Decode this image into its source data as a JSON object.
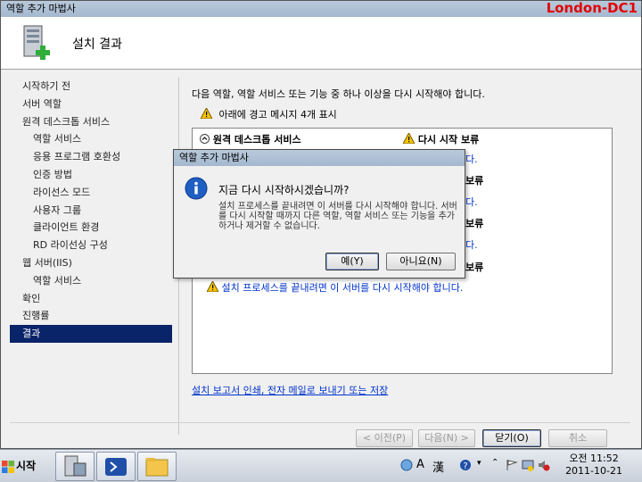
{
  "window": {
    "title": "역할 추가 마법사",
    "host_label": "London-DC1"
  },
  "header": {
    "title": "설치 결과"
  },
  "nav": {
    "items": [
      {
        "label": "시작하기 전",
        "sub": false,
        "active": false
      },
      {
        "label": "서버 역할",
        "sub": false,
        "active": false
      },
      {
        "label": "원격 데스크톱 서비스",
        "sub": false,
        "active": false
      },
      {
        "label": "역할 서비스",
        "sub": true,
        "active": false
      },
      {
        "label": "응용 프로그램 호환성",
        "sub": true,
        "active": false
      },
      {
        "label": "인증 방법",
        "sub": true,
        "active": false
      },
      {
        "label": "라이선스 모드",
        "sub": true,
        "active": false
      },
      {
        "label": "사용자 그룹",
        "sub": true,
        "active": false
      },
      {
        "label": "클라이언트 환경",
        "sub": true,
        "active": false
      },
      {
        "label": "RD 라이선싱 구성",
        "sub": true,
        "active": false
      },
      {
        "label": "웹 서버(IIS)",
        "sub": false,
        "active": false
      },
      {
        "label": "역할 서비스",
        "sub": true,
        "active": false
      },
      {
        "label": "확인",
        "sub": false,
        "active": false
      },
      {
        "label": "진행률",
        "sub": false,
        "active": false
      },
      {
        "label": "결과",
        "sub": false,
        "active": true
      }
    ]
  },
  "main": {
    "intro": "다음 역할, 역할 서비스 또는 기능 중 하나 이상을 다시 시작해야 합니다.",
    "warning_summary": "아래에 경고 메시지 4개 표시",
    "result_header": {
      "name": "원격 데스크톱 서비스",
      "status": "다시 시작 보류"
    },
    "partial_rows": [
      "다.",
      "보류",
      "다.",
      "보류",
      "다.",
      "보류"
    ],
    "warning_line": "설치 프로세스를 끝내려면 이 서버를 다시 시작해야 합니다.",
    "report_link": "설치 보고서 인쇄, 전자 메일로 보내기 또는 저장"
  },
  "buttons": {
    "prev": "< 이전(P)",
    "next": "다음(N) >",
    "close": "닫기(O)",
    "cancel": "취소"
  },
  "dialog": {
    "title": "역할 추가 마법사",
    "question": "지금 다시 시작하시겠습니까?",
    "detail": "설치 프로세스를 끝내려면 이 서버를 다시 시작해야 합니다. 서버를 다시 시작할 때까지 다른 역할, 역할 서비스 또는 기능을 추가하거나 제거할 수 없습니다.",
    "yes": "예(Y)",
    "no": "아니요(N)"
  },
  "taskbar": {
    "start": "시작",
    "ime_a": "A",
    "ime_han": "漢",
    "time": "오전 11:52",
    "date": "2011-10-21"
  },
  "colors": {
    "nav_active": "#0a246a",
    "link": "#0033cc",
    "host_label": "#e00000"
  }
}
